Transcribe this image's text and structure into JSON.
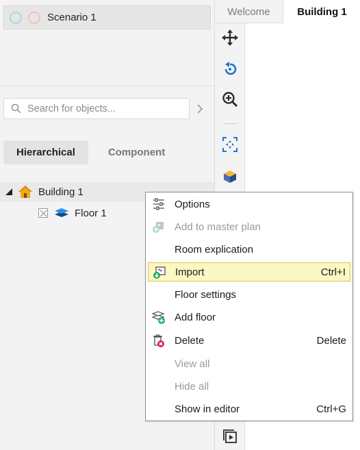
{
  "scenario": {
    "label": "Scenario 1"
  },
  "search": {
    "placeholder": "Search for objects..."
  },
  "view_tabs": {
    "hierarchical": "Hierarchical",
    "component": "Component"
  },
  "tree": {
    "building": {
      "label": "Building 1"
    },
    "floor": {
      "label": "Floor 1"
    }
  },
  "doc_tabs": {
    "welcome": "Welcome",
    "building": "Building 1"
  },
  "toolbar": {
    "tools": [
      "move-icon",
      "rotate-icon",
      "zoom-in-icon",
      "fit-extents-icon",
      "cube-icon",
      "play-icon"
    ]
  },
  "menu": {
    "items": [
      {
        "label": "Options",
        "shortcut": "",
        "enabled": true
      },
      {
        "label": "Add to master plan",
        "shortcut": "",
        "enabled": false
      },
      {
        "label": "Room explication",
        "shortcut": "",
        "enabled": true
      },
      {
        "label": "Import",
        "shortcut": "Ctrl+I",
        "enabled": true,
        "highlighted": true
      },
      {
        "label": "Floor settings",
        "shortcut": "",
        "enabled": true
      },
      {
        "label": "Add floor",
        "shortcut": "",
        "enabled": true
      },
      {
        "label": "Delete",
        "shortcut": "Delete",
        "enabled": true
      },
      {
        "label": "View all",
        "shortcut": "",
        "enabled": false
      },
      {
        "label": "Hide all",
        "shortcut": "",
        "enabled": false
      },
      {
        "label": "Show in editor",
        "shortcut": "Ctrl+G",
        "enabled": true
      }
    ]
  },
  "colors": {
    "accent_blue": "#1e73d2",
    "highlight_bg": "#fdf7c3",
    "highlight_border": "#d9c63c",
    "house_orange": "#f2a81c"
  }
}
